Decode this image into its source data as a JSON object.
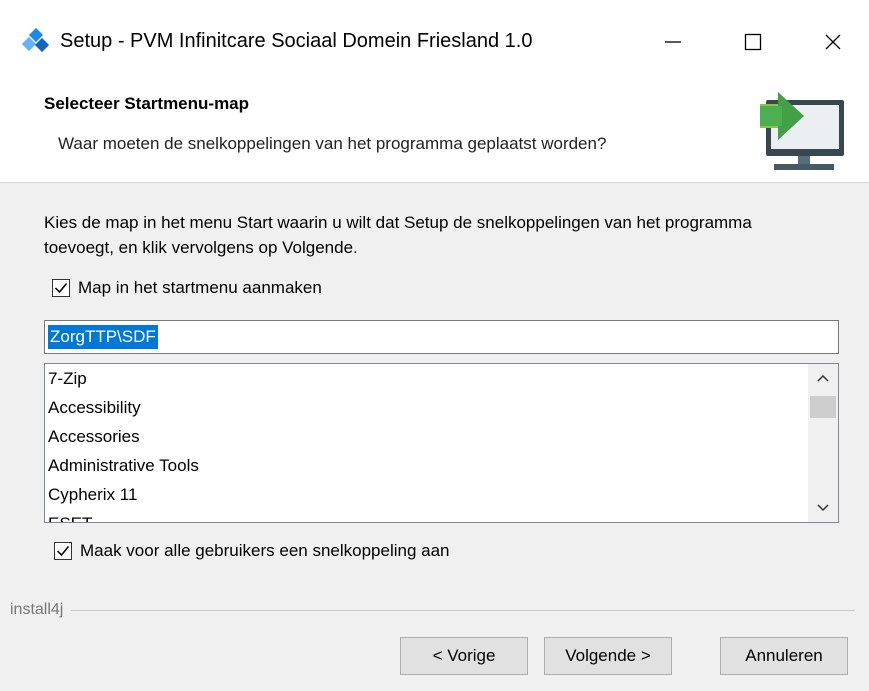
{
  "window": {
    "title": "Setup - PVM Infinitcare Sociaal Domein Friesland 1.0",
    "icons": {
      "app": "installer-icon",
      "minimize": "minimize-icon",
      "maximize": "maximize-icon",
      "close": "close-icon"
    }
  },
  "header": {
    "title": "Selecteer Startmenu-map",
    "subtitle": "Waar moeten de snelkoppelingen van het programma geplaatst worden?",
    "icon": "computer-install-arrow-icon"
  },
  "main": {
    "description": "Kies de map in het menu Start waarin u wilt dat Setup de snelkoppelingen van het programma toevoegt, en klik vervolgens op Volgende.",
    "create_folder_checkbox": {
      "label": "Map in het startmenu aanmaken",
      "checked": true
    },
    "folder_input": {
      "value": "ZorgTTP\\SDF"
    },
    "folder_list": {
      "items": [
        "7-Zip",
        "Accessibility",
        "Accessories",
        "Administrative Tools",
        "Cypherix 11",
        "ESET"
      ]
    },
    "all_users_checkbox": {
      "label": "Maak voor alle gebruikers een snelkoppeling aan",
      "checked": true
    }
  },
  "footer": {
    "brand": "install4j",
    "buttons": {
      "back": "< Vorige",
      "next": "Volgende >",
      "cancel": "Annuleren"
    }
  },
  "colors": {
    "selection": "#0078d7",
    "accent_green": "#3fb53a",
    "dialog_bg": "#f0f0f0"
  }
}
